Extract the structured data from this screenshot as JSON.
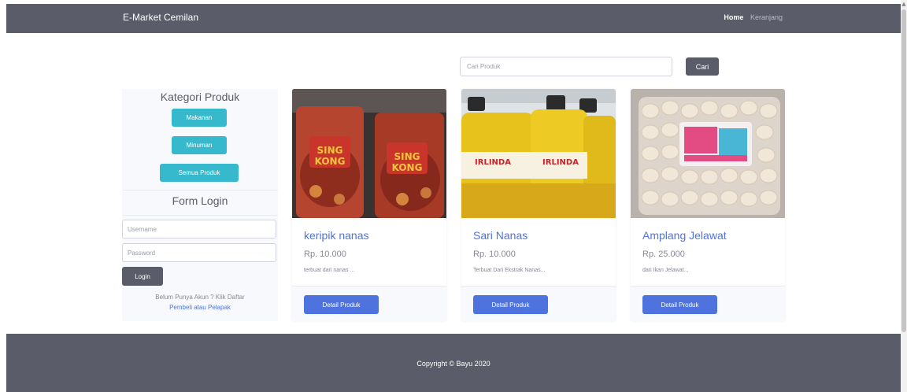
{
  "navbar": {
    "brand": "E-Market Cemilan",
    "links": {
      "home": "Home",
      "cart": "Keranjang"
    }
  },
  "search": {
    "placeholder": "Cari Produk",
    "button": "Cari"
  },
  "sidebar": {
    "category_title": "Kategori Produk",
    "categories": [
      "Makanan",
      "Minuman",
      "Semua Produk"
    ],
    "login_title": "Form Login",
    "username_placeholder": "Username",
    "password_placeholder": "Password",
    "login_button": "Login",
    "register_text": "Belum Punya Akun ? Klik Daftar",
    "register_link": "Pembeli atau Pelapak"
  },
  "products": [
    {
      "name": "keripik nanas",
      "price": "Rp. 10.000",
      "description": "terbuat dari nanas ...",
      "button": "Detail Produk"
    },
    {
      "name": "Sari Nanas",
      "price": "Rp. 10.000",
      "description": "Terbuat Dari Ekstrak Nanas...",
      "button": "Detail Produk"
    },
    {
      "name": "Amplang Jelawat",
      "price": "Rp. 25.000",
      "description": "dari Ikan Jelawat...",
      "button": "Detail Produk"
    }
  ],
  "footer": {
    "copyright": "Copyright © Bayu 2020"
  },
  "colors": {
    "navbar_bg": "#5a5c69",
    "info_btn": "#36b9cc",
    "primary": "#4e73df",
    "muted_text": "#858796"
  }
}
